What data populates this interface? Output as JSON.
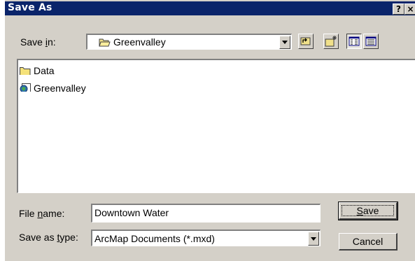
{
  "window": {
    "title": "Save As",
    "help_label": "?",
    "close_label": "×"
  },
  "location": {
    "label": "Save in:",
    "label_parts": [
      "Save ",
      "i",
      "n:"
    ],
    "value": "Greenvalley"
  },
  "toolbar": {
    "buttons": [
      {
        "icon": "up-one-level-icon"
      },
      {
        "icon": "new-folder-icon"
      },
      {
        "icon": "list-view-icon",
        "pressed": true
      },
      {
        "icon": "details-view-icon"
      }
    ]
  },
  "files": [
    {
      "name": "Data",
      "icon": "folder-icon"
    },
    {
      "name": "Greenvalley",
      "icon": "map-document-icon"
    }
  ],
  "filename": {
    "label": "File name:",
    "label_parts": [
      "File ",
      "n",
      "ame:"
    ],
    "value": "Downtown Water"
  },
  "filetype": {
    "label": "Save as type:",
    "label_parts": [
      "Save as ",
      "t",
      "ype:"
    ],
    "value": "ArcMap Documents (*.mxd)"
  },
  "buttons": {
    "save": "Save",
    "save_parts": [
      "",
      "S",
      "ave"
    ],
    "cancel": "Cancel"
  }
}
